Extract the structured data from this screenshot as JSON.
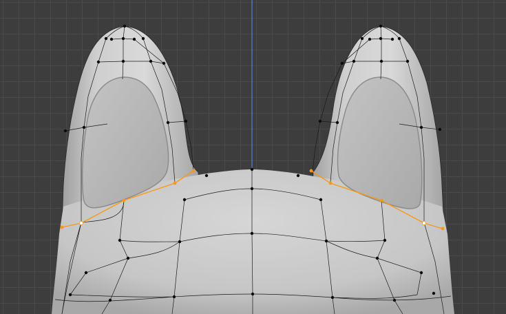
{
  "viewport": {
    "mode": "edit",
    "view": "front-orthographic",
    "grid_visible": true
  },
  "colors": {
    "background": "#3d3d3d",
    "grid_line": "#4a4a4a",
    "mesh_surface": "#c9c9c9",
    "wire": "#1a1a1a",
    "vertex": "#0b0b0b",
    "selected_edge": "#f39a1a",
    "active_vertex": "#ffffff",
    "z_axis": "#5a7fd0"
  },
  "mesh": {
    "object": "character-head",
    "ears": 2,
    "selected_edge_loops": 2
  }
}
